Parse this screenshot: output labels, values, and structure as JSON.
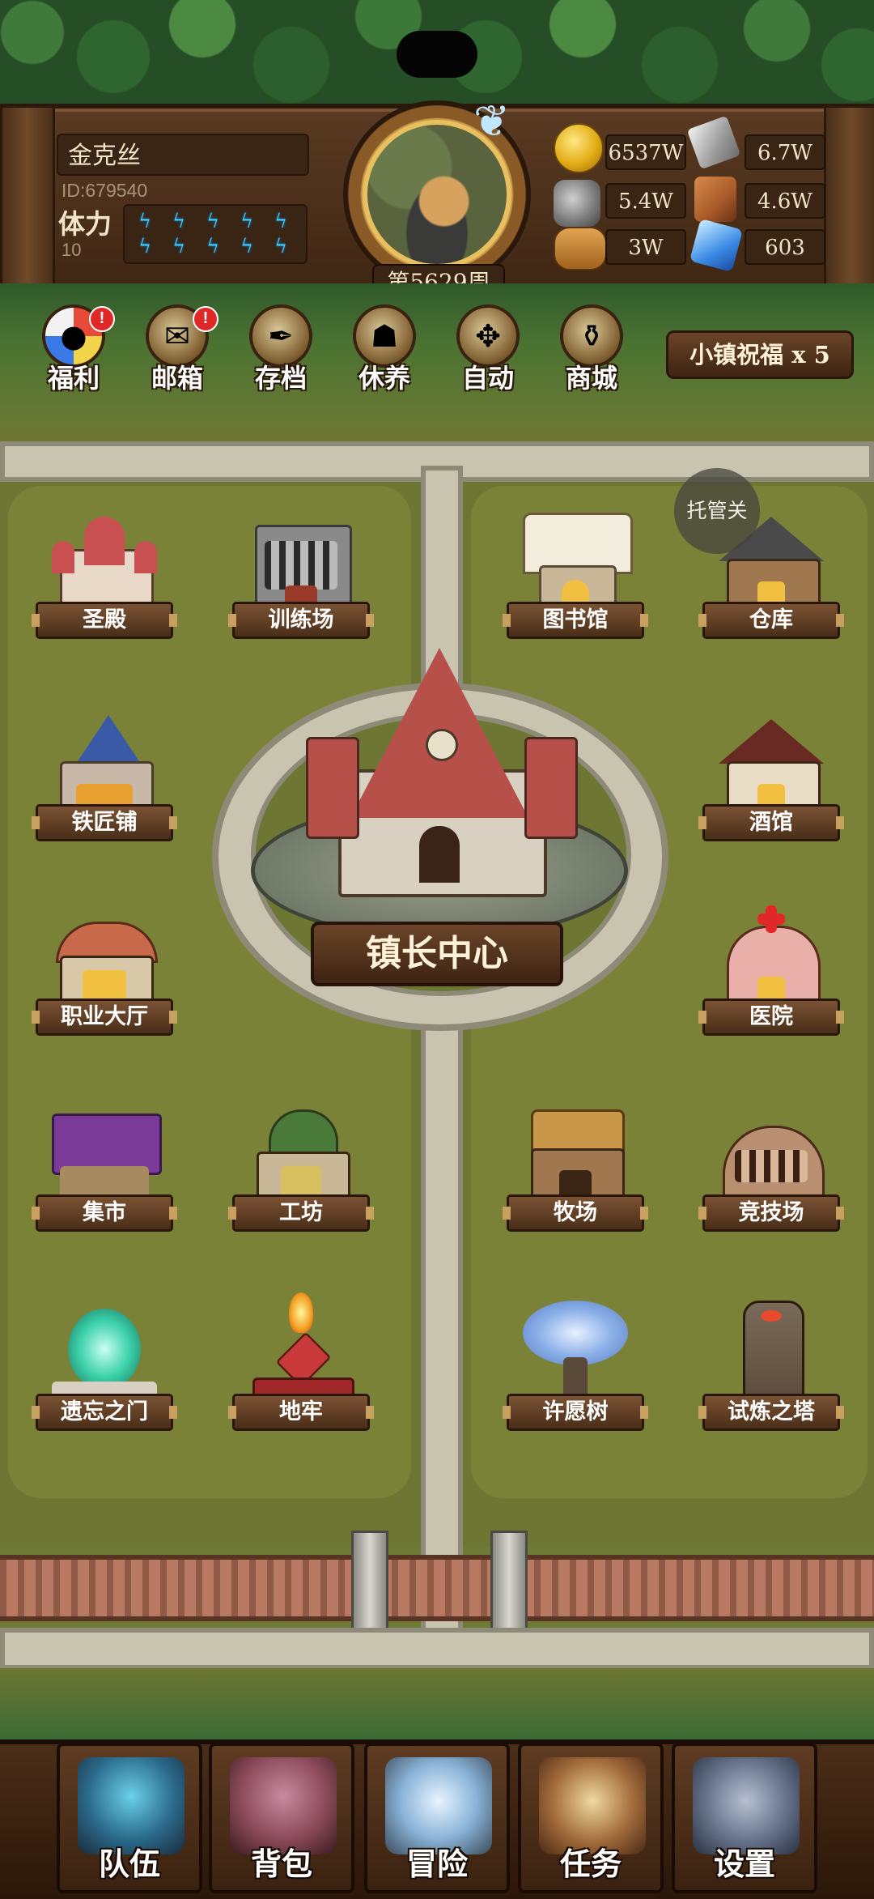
{
  "player": {
    "name": "金克丝",
    "id": "ID:679540",
    "stamina_label": "体力",
    "stamina_value": "10",
    "stamina_bolts": 10,
    "week": "第5629周"
  },
  "resources": {
    "gold": "6537W",
    "iron": "6.7W",
    "stone": "5.4W",
    "hide": "4.6W",
    "wood": "3W",
    "crystal": "603"
  },
  "menu": [
    {
      "label": "福利",
      "icon": "wheel-icon",
      "alert": "!"
    },
    {
      "label": "邮箱",
      "icon": "mail-icon",
      "alert": "!"
    },
    {
      "label": "存档",
      "icon": "scroll-quill-icon"
    },
    {
      "label": "休养",
      "icon": "rest-scroll-icon"
    },
    {
      "label": "自动",
      "icon": "auto-map-icon"
    },
    {
      "label": "商城",
      "icon": "shop-bag-icon"
    }
  ],
  "town_blessing": "小镇祝福 x 5",
  "trustee": "托管关",
  "town_hall": "镇长中心",
  "buildings": {
    "holy_hall": "圣殿",
    "training_ground": "训练场",
    "library": "图书馆",
    "warehouse": "仓库",
    "blacksmith": "铁匠铺",
    "tavern": "酒馆",
    "job_hall": "职业大厅",
    "hospital": "医院",
    "market": "集市",
    "workshop": "工坊",
    "ranch": "牧场",
    "arena": "竞技场",
    "forgotten_gate": "遗忘之门",
    "dungeon": "地牢",
    "wishing_tree": "许愿树",
    "trial_tower": "试炼之塔"
  },
  "bottom_nav": [
    {
      "label": "队伍",
      "icon": "helmet-icon"
    },
    {
      "label": "背包",
      "icon": "backpack-icon"
    },
    {
      "label": "冒险",
      "icon": "crossed-swords-icon"
    },
    {
      "label": "任务",
      "icon": "quest-scroll-icon"
    },
    {
      "label": "设置",
      "icon": "gear-icon"
    }
  ],
  "colors": {
    "wood_dark": "#3a2414",
    "grass": "#6e7634",
    "road": "#c8c4b0",
    "stamina_bolt": "#3fd0ff",
    "alert_red": "#e02828"
  }
}
